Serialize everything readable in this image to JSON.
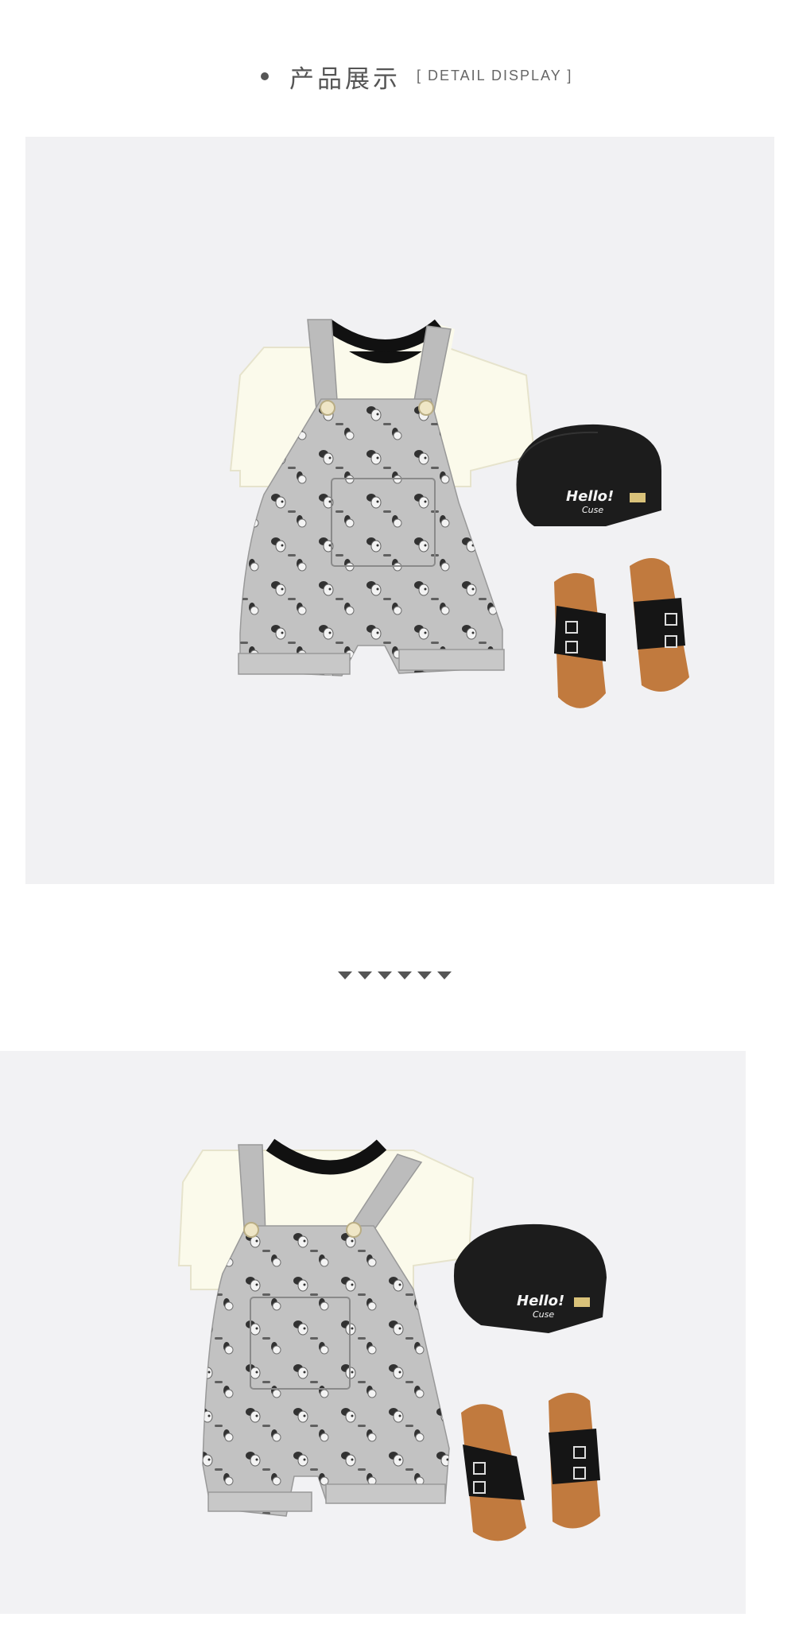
{
  "section_header": {
    "title_cn": "产品展示",
    "title_en": "[ DETAIL DISPLAY ]"
  },
  "products": {
    "cap_text_line1": "Hello!",
    "cap_text_line2": "Cuse"
  },
  "colors": {
    "overall_gray": "#bcbcbc",
    "tee_cream": "#fbfaeb",
    "cap_black": "#1c1c1c",
    "sandal_cork": "#c17a3e"
  }
}
